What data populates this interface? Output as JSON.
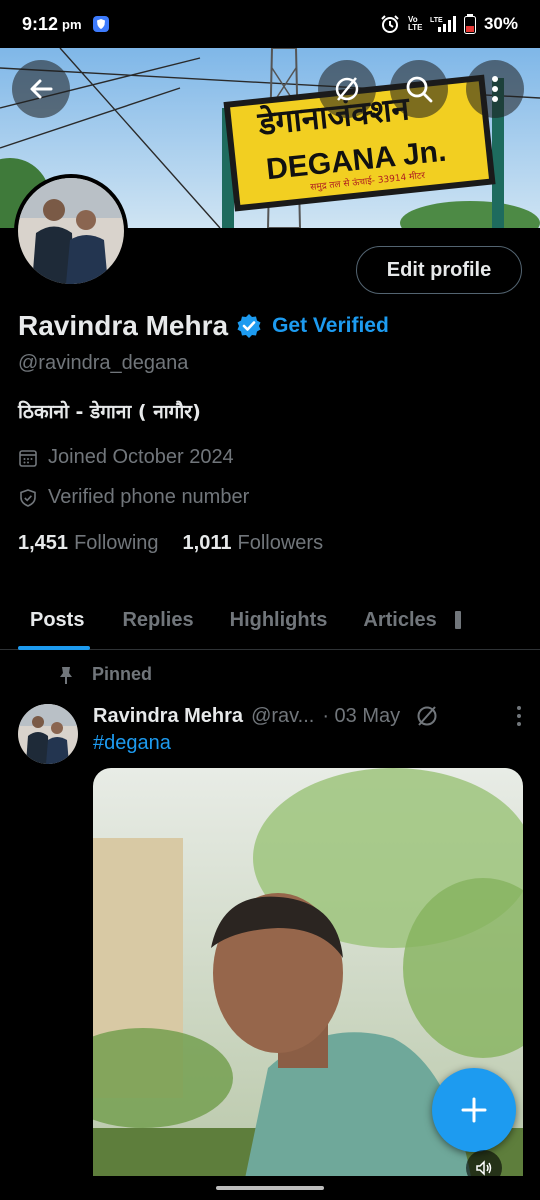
{
  "status_bar": {
    "time": "9:12",
    "ampm": "pm",
    "battery": "30%",
    "volte": "Vo LTE",
    "lte": "LTE"
  },
  "banner": {
    "sign_hindi": "डेगानाजंक्शन",
    "sign_english": "DEGANA Jn.",
    "sign_small": "समुद्र तल से ऊंचाई- 33914 मीटर",
    "back_icon": "arrow-left-icon",
    "icons": [
      "refresh-slash-icon",
      "search-icon",
      "more-vertical-icon"
    ]
  },
  "profile": {
    "edit_label": "Edit profile",
    "name": "Ravindra Mehra",
    "get_verified": "Get Verified",
    "handle": "@ravindra_degana",
    "bio": "ठिकानो - डेगाना ( नागौर)",
    "joined": "Joined October 2024",
    "verified_phone": "Verified phone number",
    "following_count": "1,451",
    "following_label": "Following",
    "followers_count": "1,011",
    "followers_label": "Followers"
  },
  "tabs": [
    {
      "label": "Posts",
      "active": true
    },
    {
      "label": "Replies",
      "active": false
    },
    {
      "label": "Highlights",
      "active": false
    },
    {
      "label": "Articles",
      "active": false
    }
  ],
  "post": {
    "pinned_label": "Pinned",
    "author_name": "Ravindra Mehra",
    "author_handle": "@rav...",
    "date": "· 03 May",
    "text": "#degana"
  },
  "colors": {
    "accent": "#1d9bf0",
    "muted": "#71767b",
    "text": "#e7e9ea",
    "background": "#000000"
  }
}
